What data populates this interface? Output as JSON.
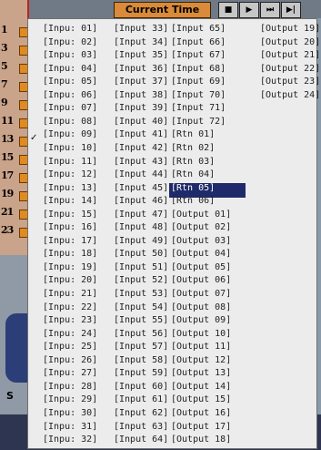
{
  "header": {
    "current_time_label": "Current Time",
    "transport": [
      "■",
      "▶",
      "⏭",
      "▶|"
    ]
  },
  "channel_numbers": [
    "1",
    "3",
    "5",
    "7",
    "9",
    "11",
    "13",
    "15",
    "17",
    "19",
    "21",
    "23"
  ],
  "menu": {
    "checked_item": "[Inpu: 09]",
    "selected_item": "[Rtn 05]",
    "col1": [
      "[Inpu: 01]",
      "[Inpu: 02]",
      "[Inpu: 03]",
      "[Inpu: 04]",
      "[Inpu: 05]",
      "[Inpu: 06]",
      "[Inpu: 07]",
      "[Inpu: 08]",
      "[Inpu: 09]",
      "[Inpu: 10]",
      "[Inpu: 11]",
      "[Inpu: 12]",
      "[Inpu: 13]",
      "[Inpu: 14]",
      "[Inpu: 15]",
      "[Inpu: 16]",
      "[Inpu: 17]",
      "[Inpu: 18]",
      "[Inpu: 19]",
      "[Inpu: 20]",
      "[Inpu: 21]",
      "[Inpu: 22]",
      "[Inpu: 23]",
      "[Inpu: 24]",
      "[Inpu: 25]",
      "[Inpu: 26]",
      "[Inpu: 27]",
      "[Inpu: 28]",
      "[Inpu: 29]",
      "[Inpu: 30]",
      "[Inpu: 31]",
      "[Inpu: 32]"
    ],
    "col2": [
      "[Input 33]",
      "[Input 34]",
      "[Input 35]",
      "[Input 36]",
      "[Input 37]",
      "[Input 38]",
      "[Input 39]",
      "[Input 40]",
      "[Input 41]",
      "[Input 42]",
      "[Input 43]",
      "[Input 44]",
      "[Input 45]",
      "[Input 46]",
      "[Input 47]",
      "[Input 48]",
      "[Input 49]",
      "[Input 50]",
      "[Input 51]",
      "[Input 52]",
      "[Input 53]",
      "[Input 54]",
      "[Input 55]",
      "[Input 56]",
      "[Input 57]",
      "[Input 58]",
      "[Input 59]",
      "[Input 60]",
      "[Input 61]",
      "[Input 62]",
      "[Input 63]",
      "[Input 64]"
    ],
    "col3": [
      "[Input 65]",
      "[Input 66]",
      "[Input 67]",
      "[Input 68]",
      "[Input 69]",
      "[Input 70]",
      "[Input 71]",
      "[Input 72]",
      "[Rtn 01]",
      "[Rtn 02]",
      "[Rtn 03]",
      "[Rtn 04]",
      "[Rtn 05]",
      "[Rtn 06]",
      "[Output 01]",
      "[Output 02]",
      "[Output 03]",
      "[Output 04]",
      "[Output 05]",
      "[Output 06]",
      "[Output 07]",
      "[Output 08]",
      "[Output 09]",
      "[Output 10]",
      "[Output 11]",
      "[Output 12]",
      "[Output 13]",
      "[Output 14]",
      "[Output 15]",
      "[Output 16]",
      "[Output 17]",
      "[Output 18]"
    ],
    "col4": [
      "[Output 19]",
      "[Output 20]",
      "[Output 21]",
      "[Output 22]",
      "[Output 23]",
      "[Output 24]"
    ]
  }
}
